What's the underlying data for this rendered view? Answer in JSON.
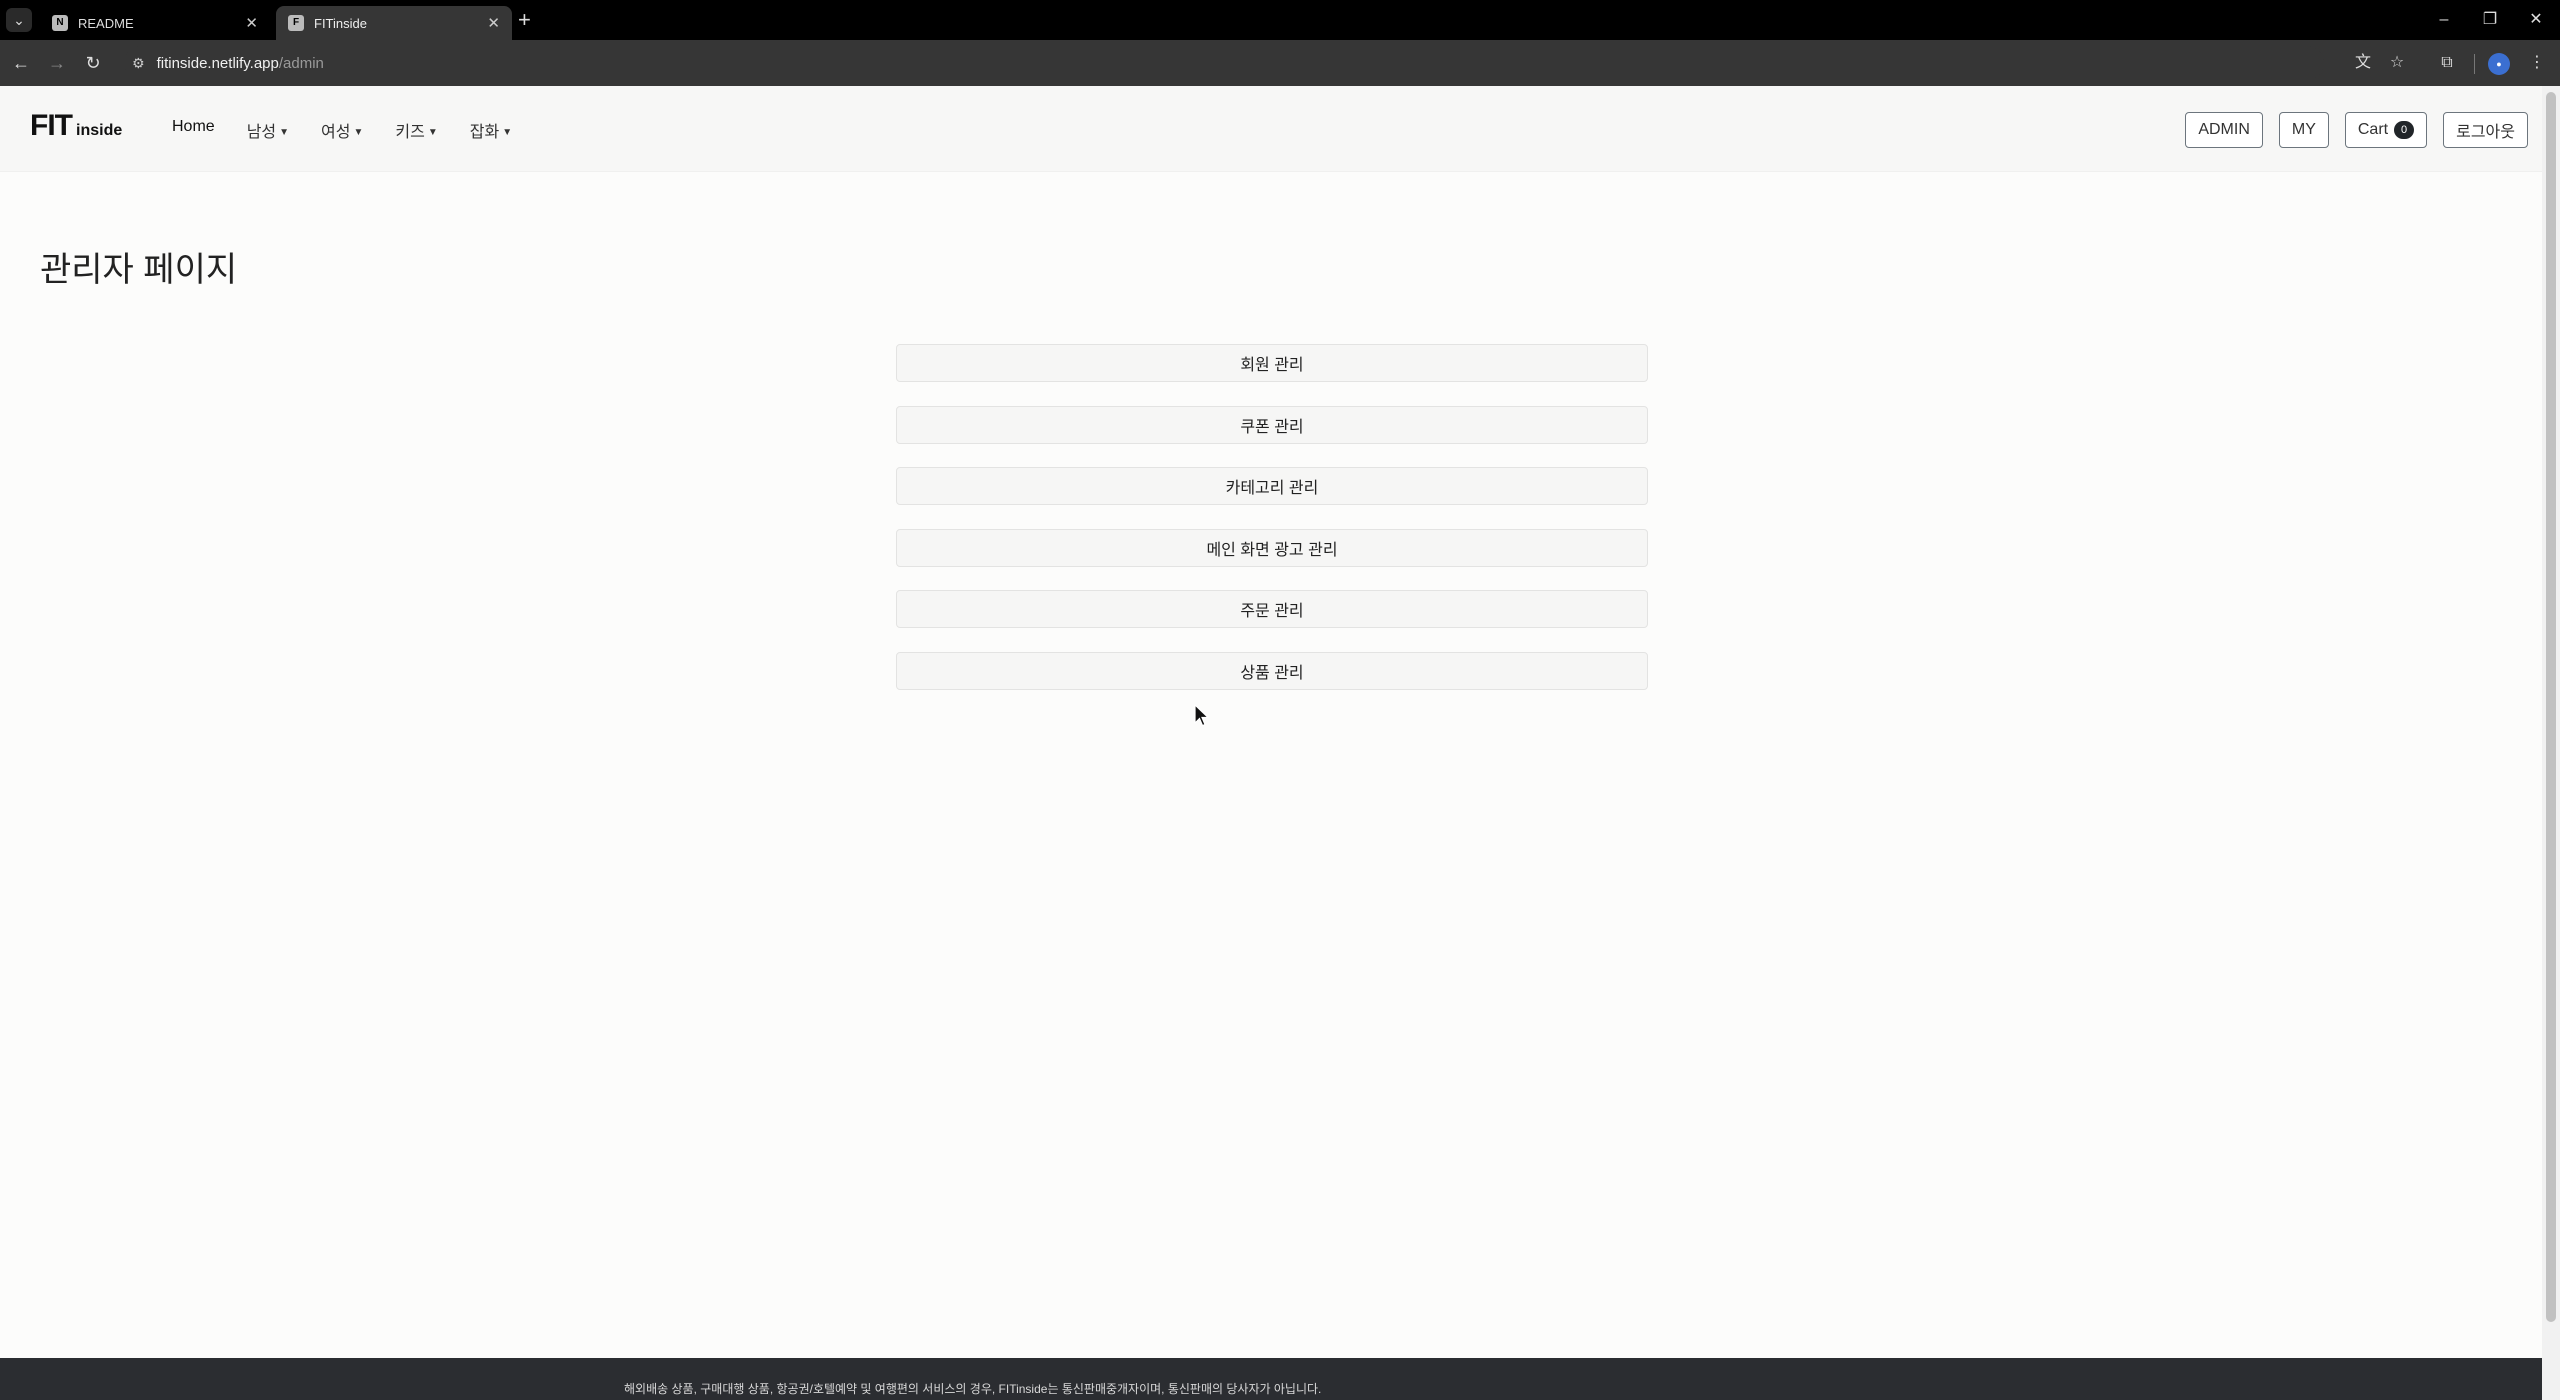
{
  "browser": {
    "tabs": [
      {
        "title": "README",
        "icon": "notion-icon",
        "active": false
      },
      {
        "title": "FITinside",
        "icon": "site-icon",
        "active": true
      }
    ],
    "url": {
      "host": "fitinside.netlify.app",
      "path": "/admin"
    }
  },
  "navbar": {
    "logo": {
      "big": "FIT",
      "small": "inside"
    },
    "links": [
      {
        "label": "Home",
        "dropdown": false
      },
      {
        "label": "남성",
        "dropdown": true
      },
      {
        "label": "여성",
        "dropdown": true
      },
      {
        "label": "키즈",
        "dropdown": true
      },
      {
        "label": "잡화",
        "dropdown": true
      }
    ],
    "buttons": {
      "admin": "ADMIN",
      "my": "MY",
      "cart": "Cart",
      "cart_count": "0",
      "logout": "로그아웃"
    }
  },
  "main": {
    "title": "관리자 페이지",
    "menu": [
      "회원 관리",
      "쿠폰 관리",
      "카테고리 관리",
      "메인 화면 광고 관리",
      "주문 관리",
      "상품 관리"
    ]
  },
  "footer": {
    "notice": "해외배송 상품, 구매대행 상품, 항공권/호텔예약 및 여행편의 서비스의 경우, FITinside는 통신판매중개자이며, 통신판매의 당사자가 아닙니다."
  },
  "colors": {
    "footer_bg": "#2b2d31",
    "badge_bg": "#212529",
    "button_border": "#6c757d"
  }
}
